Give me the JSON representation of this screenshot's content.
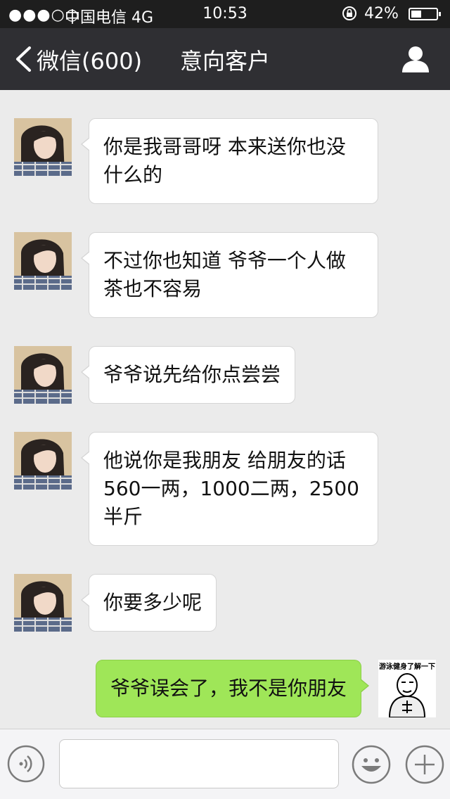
{
  "status_bar": {
    "signal": "●●●○○",
    "carrier": "中国电信  4G",
    "time": "10:53",
    "battery_pct": "42%",
    "battery_level": 0.42,
    "rotation_lock_icon": "rotation-lock-icon"
  },
  "nav": {
    "back_label": "微信(600)",
    "title": "意向客户",
    "back_icon": "chevron-left-icon",
    "profile_icon": "person-icon"
  },
  "messages": [
    {
      "side": "left",
      "text": "你是我哥哥呀 本来送你也没什么的"
    },
    {
      "side": "left",
      "text": "不过你也知道 爷爷一个人做茶也不容易"
    },
    {
      "side": "left",
      "text": "爷爷说先给你点尝尝"
    },
    {
      "side": "left",
      "text": "他说你是我朋友 给朋友的话560一两，1000二两，2500半斤"
    },
    {
      "side": "left",
      "text": "你要多少呢"
    },
    {
      "side": "right",
      "text": "爷爷误会了，我不是你朋友"
    }
  ],
  "my_avatar_caption": "游泳健身了解一下",
  "input_bar": {
    "voice_icon": "voice-icon",
    "emoji_icon": "emoji-icon",
    "plus_icon": "plus-icon",
    "value": ""
  },
  "colors": {
    "nav_bg": "#2f2f33",
    "chat_bg": "#ebebeb",
    "sent_bubble": "#9fe658",
    "received_bubble": "#ffffff"
  }
}
